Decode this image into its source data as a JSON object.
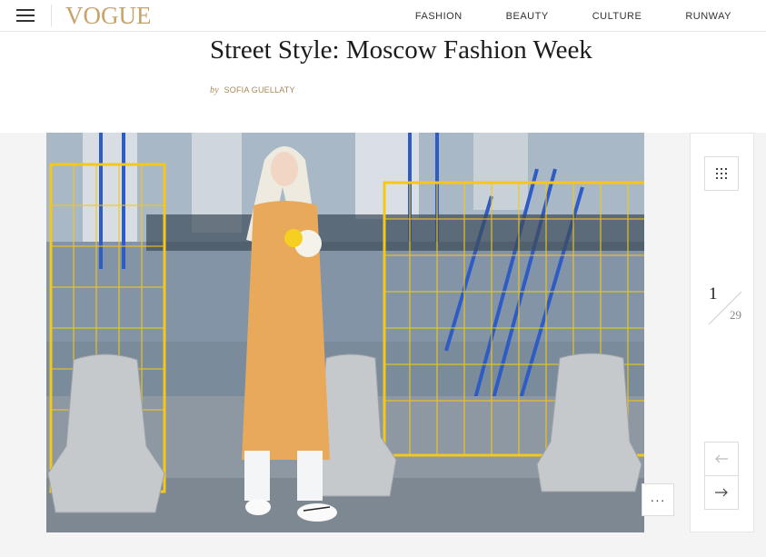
{
  "header": {
    "logo_text": "VOGUE",
    "nav": [
      "FASHION",
      "BEAUTY",
      "CULTURE",
      "RUNWAY"
    ]
  },
  "article": {
    "title": "Street Style: Moscow Fashion Week",
    "by_prefix": "by",
    "author": "SOFIA GUELLATY"
  },
  "gallery": {
    "current": "1",
    "total": "29",
    "more_label": "···"
  },
  "colors": {
    "accent_gold": "#c8a36a",
    "byline": "#a88757",
    "coat": "#e8a95a",
    "fence": "#f2c81a",
    "scaffold_blue": "#2f5bc4"
  },
  "icons": {
    "menu": "menu-icon",
    "grid": "grid-icon",
    "prev": "arrow-left-icon",
    "next": "arrow-right-icon"
  }
}
